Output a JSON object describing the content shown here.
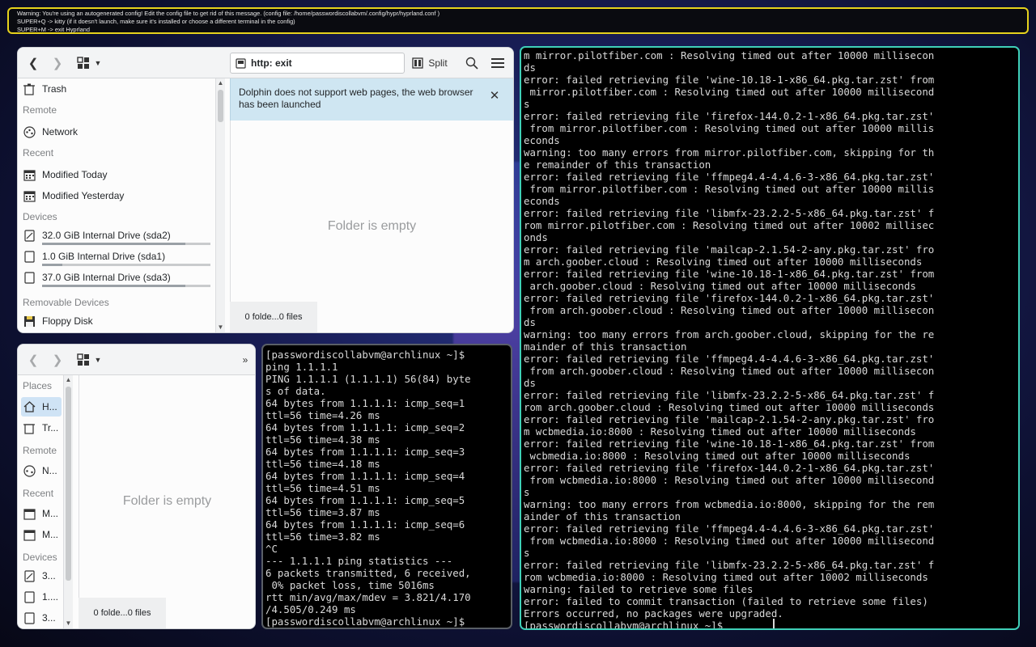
{
  "banner": {
    "lines": [
      "Warning: You're using an autogenerated config! Edit the config file to get rid of this message. (config file: /home/passwordiscollabvm/.config/hypr/hyprland.conf )",
      "SUPER+Q -> kitty (if it doesn't launch, make sure it's installed or choose a different terminal in the config)",
      "SUPER+M -> exit Hyprland"
    ]
  },
  "dolphin_top": {
    "location": "http: exit",
    "split_label": "Split",
    "notice": "Dolphin does not support web pages, the web browser has been launched",
    "empty_text": "Folder is empty",
    "status": "0 folde...0 files",
    "places": {
      "trash": "Trash",
      "remote_head": "Remote",
      "network": "Network",
      "recent_head": "Recent",
      "modified_today": "Modified Today",
      "modified_yesterday": "Modified Yesterday",
      "devices_head": "Devices",
      "drive1": "32.0 GiB Internal Drive (sda2)",
      "drive2": "1.0 GiB Internal Drive (sda1)",
      "drive3": "37.0 GiB Internal Drive (sda3)",
      "removable_head": "Removable Devices",
      "floppy": "Floppy Disk"
    },
    "drive_usage": [
      0.85,
      0.12,
      0.85
    ]
  },
  "dolphin_bottom": {
    "empty_text": "Folder is empty",
    "status": "0 folde...0 files",
    "places": {
      "places_head": "Places",
      "home": "H...",
      "trash": "Tr...",
      "remote_head": "Remote",
      "network": "N...",
      "recent_head": "Recent",
      "modified_today": "M...",
      "modified_yesterday": "M...",
      "devices_head": "Devices",
      "drive1": "3...",
      "drive2": "1....",
      "drive3": "3..."
    }
  },
  "terminal_ping": {
    "lines": [
      "[passwordiscollabvm@archlinux ~]$",
      "ping 1.1.1.1",
      "PING 1.1.1.1 (1.1.1.1) 56(84) byte",
      "s of data.",
      "64 bytes from 1.1.1.1: icmp_seq=1",
      "ttl=56 time=4.26 ms",
      "64 bytes from 1.1.1.1: icmp_seq=2",
      "ttl=56 time=4.38 ms",
      "64 bytes from 1.1.1.1: icmp_seq=3",
      "ttl=56 time=4.18 ms",
      "64 bytes from 1.1.1.1: icmp_seq=4",
      "ttl=56 time=4.51 ms",
      "64 bytes from 1.1.1.1: icmp_seq=5",
      "ttl=56 time=3.87 ms",
      "64 bytes from 1.1.1.1: icmp_seq=6",
      "ttl=56 time=3.82 ms",
      "^C",
      "--- 1.1.1.1 ping statistics ---",
      "6 packets transmitted, 6 received,",
      " 0% packet loss, time 5016ms",
      "rtt min/avg/max/mdev = 3.821/4.170",
      "/4.505/0.249 ms",
      "[passwordiscollabvm@archlinux ~]$"
    ]
  },
  "terminal_pacman": {
    "lines": [
      "m mirror.pilotfiber.com : Resolving timed out after 10000 millisecon",
      "ds",
      "error: failed retrieving file 'wine-10.18-1-x86_64.pkg.tar.zst' from",
      " mirror.pilotfiber.com : Resolving timed out after 10000 millisecond",
      "s",
      "error: failed retrieving file 'firefox-144.0.2-1-x86_64.pkg.tar.zst'",
      " from mirror.pilotfiber.com : Resolving timed out after 10000 millis",
      "econds",
      "warning: too many errors from mirror.pilotfiber.com, skipping for th",
      "e remainder of this transaction",
      "error: failed retrieving file 'ffmpeg4.4-4.4.6-3-x86_64.pkg.tar.zst'",
      " from mirror.pilotfiber.com : Resolving timed out after 10000 millis",
      "econds",
      "error: failed retrieving file 'libmfx-23.2.2-5-x86_64.pkg.tar.zst' f",
      "rom mirror.pilotfiber.com : Resolving timed out after 10002 millisec",
      "onds",
      "error: failed retrieving file 'mailcap-2.1.54-2-any.pkg.tar.zst' fro",
      "m arch.goober.cloud : Resolving timed out after 10000 milliseconds",
      "error: failed retrieving file 'wine-10.18-1-x86_64.pkg.tar.zst' from",
      " arch.goober.cloud : Resolving timed out after 10000 milliseconds",
      "error: failed retrieving file 'firefox-144.0.2-1-x86_64.pkg.tar.zst'",
      " from arch.goober.cloud : Resolving timed out after 10000 millisecon",
      "ds",
      "warning: too many errors from arch.goober.cloud, skipping for the re",
      "mainder of this transaction",
      "error: failed retrieving file 'ffmpeg4.4-4.4.6-3-x86_64.pkg.tar.zst'",
      " from arch.goober.cloud : Resolving timed out after 10000 millisecon",
      "ds",
      "error: failed retrieving file 'libmfx-23.2.2-5-x86_64.pkg.tar.zst' f",
      "rom arch.goober.cloud : Resolving timed out after 10000 milliseconds",
      "error: failed retrieving file 'mailcap-2.1.54-2-any.pkg.tar.zst' fro",
      "m wcbmedia.io:8000 : Resolving timed out after 10000 milliseconds",
      "error: failed retrieving file 'wine-10.18-1-x86_64.pkg.tar.zst' from",
      " wcbmedia.io:8000 : Resolving timed out after 10000 milliseconds",
      "error: failed retrieving file 'firefox-144.0.2-1-x86_64.pkg.tar.zst'",
      " from wcbmedia.io:8000 : Resolving timed out after 10000 millisecond",
      "s",
      "warning: too many errors from wcbmedia.io:8000, skipping for the rem",
      "ainder of this transaction",
      "error: failed retrieving file 'ffmpeg4.4-4.4.6-3-x86_64.pkg.tar.zst'",
      " from wcbmedia.io:8000 : Resolving timed out after 10000 millisecond",
      "s",
      "error: failed retrieving file 'libmfx-23.2.2-5-x86_64.pkg.tar.zst' f",
      "rom wcbmedia.io:8000 : Resolving timed out after 10002 milliseconds",
      "warning: failed to retrieve some files",
      "error: failed to commit transaction (failed to retrieve some files)",
      "Errors occurred, no packages were upgraded.",
      "[passwordiscollabvm@archlinux ~]$ "
    ]
  },
  "colors": {
    "banner_border": "#e6d21c",
    "active_border": "#3fd0b8",
    "notice_bg": "#cfe6f2"
  }
}
